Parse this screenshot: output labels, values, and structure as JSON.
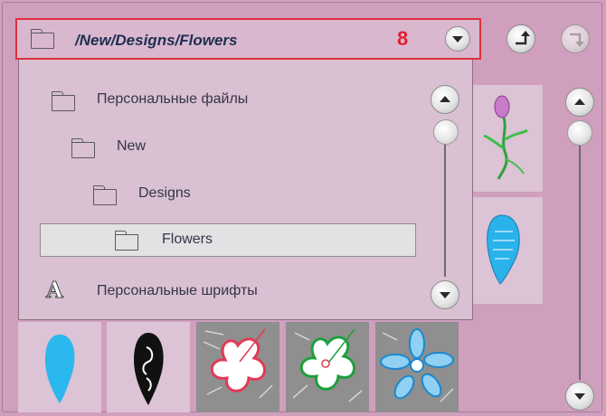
{
  "path_bar": {
    "current_path": "/New/Designs/Flowers",
    "badge_number": "8"
  },
  "folder_tree": {
    "items": [
      {
        "label": "Персональные файлы",
        "icon": "folder-icon",
        "selected": false
      },
      {
        "label": "New",
        "icon": "folder-icon",
        "selected": false
      },
      {
        "label": "Designs",
        "icon": "folder-icon",
        "selected": false
      },
      {
        "label": "Flowers",
        "icon": "folder-icon",
        "selected": true
      },
      {
        "label": "Персональные шрифты",
        "icon": "font-icon",
        "selected": false
      }
    ]
  },
  "navigation": {
    "up_icon": "folder-up-icon",
    "down_icon": "folder-down-icon",
    "dropdown_icon": "chevron-down-icon"
  },
  "thumbnails": [
    {
      "name": "rose-stem-design"
    },
    {
      "name": "blue-leaf-pattern-design"
    },
    {
      "name": "blue-leaf-design"
    },
    {
      "name": "black-paisley-design"
    },
    {
      "name": "pink-flower-design"
    },
    {
      "name": "green-flower-design"
    },
    {
      "name": "blue-flower-design"
    }
  ],
  "colors": {
    "background": "#cf9fbd",
    "highlight_border": "#e0303c",
    "path_text": "#1e2e52",
    "selection": "#e3e1e3"
  }
}
